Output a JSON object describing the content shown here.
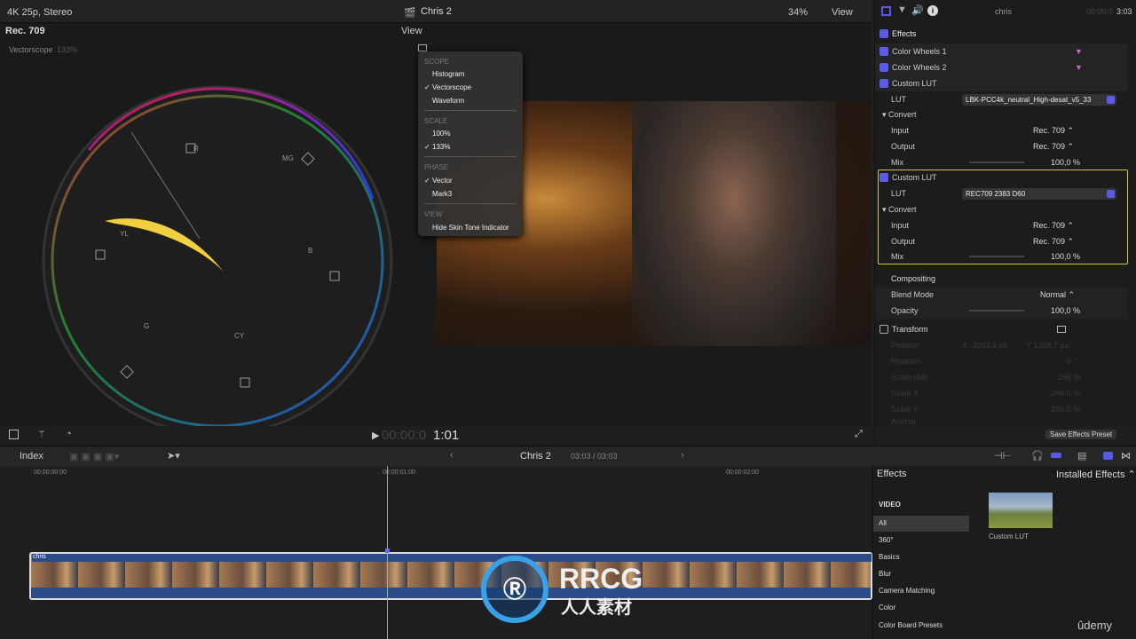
{
  "topbar": {
    "format": "4K 25p, Stereo",
    "title": "Chris 2",
    "zoom": "34%",
    "view": "View"
  },
  "scope": {
    "colorspace": "Rec. 709",
    "view": "View",
    "name": "Vectorscope",
    "scale": "133%",
    "labels": {
      "r": "R",
      "mg": "MG",
      "b": "B",
      "cy": "CY",
      "g": "G",
      "yl": "YL"
    }
  },
  "scope_menu": {
    "scope_header": "SCOPE",
    "histogram": "Histogram",
    "vectorscope": "Vectorscope",
    "waveform": "Waveform",
    "scale_header": "SCALE",
    "s100": "100%",
    "s133": "133%",
    "phase_header": "PHASE",
    "vector": "Vector",
    "mark3": "Mark3",
    "view_header": "VIEW",
    "hide_skin": "Hide Skin Tone Indicator",
    "check": "✓"
  },
  "viewer": {
    "timecode_dim": "00:00:0",
    "timecode": "1:01"
  },
  "inspector": {
    "clip": "chris",
    "time_dim": "00:00:0",
    "time": "3:03",
    "effects": "Effects",
    "cw1": "Color Wheels 1",
    "cw2": "Color Wheels 2",
    "lut1": {
      "title": "Custom LUT",
      "lut_label": "LUT",
      "lut": "LBK-PCC4k_neutral_High-desat_v5_33",
      "convert": "Convert",
      "input_label": "Input",
      "input": "Rec. 709 ⌃",
      "output_label": "Output",
      "output": "Rec. 709 ⌃",
      "mix_label": "Mix",
      "mix": "100,0 %"
    },
    "lut2": {
      "title": "Custom LUT",
      "lut_label": "LUT",
      "lut": "REC709 2383 D60",
      "convert": "Convert",
      "input_label": "Input",
      "input": "Rec. 709 ⌃",
      "output_label": "Output",
      "output": "Rec. 709 ⌃",
      "mix_label": "Mix",
      "mix": "100,0 %"
    },
    "compositing": "Compositing",
    "blend_label": "Blend Mode",
    "blend": "Normal ⌃",
    "opacity_label": "Opacity",
    "opacity": "100,0 %",
    "transform": "Transform",
    "position": "Position",
    "pos_x": "X  -3263,3 px",
    "pos_y": "Y  1368,7 px",
    "rotation": "Rotation",
    "rot": "0 °",
    "scale_all": "Scale (All)",
    "scale_all_v": "266 %",
    "scale_x": "Scale X",
    "scale_x_v": "266,0 %",
    "scale_y": "Scale Y",
    "scale_y_v": "266,0 %",
    "anchor": "Anchor",
    "save_preset": "Save Effects Preset"
  },
  "timeline": {
    "index": "Index",
    "project": "Chris 2",
    "duration": "03:03 / 03:03",
    "ticks": [
      "00:00:00:00",
      "00:00:01:00",
      "00:00:02:00"
    ],
    "clip": "chris"
  },
  "browser": {
    "title": "Effects",
    "installed": "Installed Effects ⌃",
    "video": "VIDEO",
    "categories": [
      "All",
      "360°",
      "Basics",
      "Blur",
      "Camera Matching",
      "Color",
      "Color Board Presets"
    ],
    "item": "Custom LUT"
  },
  "watermark": {
    "main": "RRCG",
    "sub": "人人素材",
    "brand": "ûdemy"
  }
}
